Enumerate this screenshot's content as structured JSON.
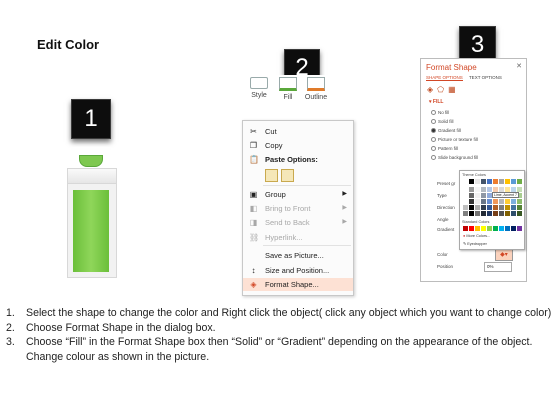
{
  "title": "Edit Color",
  "steps": [
    "1",
    "2",
    "3"
  ],
  "ribbon": {
    "items": [
      "Style",
      "Fill",
      "Outline"
    ]
  },
  "context_menu": {
    "items": [
      {
        "label": "Cut",
        "icon": "scissors-icon",
        "disabled": false,
        "arrow": false
      },
      {
        "label": "Copy",
        "icon": "copy-icon",
        "disabled": false,
        "arrow": false
      },
      {
        "label": "Paste Options:",
        "icon": "paste-icon",
        "disabled": false,
        "arrow": false,
        "bold": true
      },
      {
        "label": "Group",
        "icon": "group-icon",
        "disabled": false,
        "arrow": true
      },
      {
        "label": "Bring to Front",
        "icon": "bring-front-icon",
        "disabled": true,
        "arrow": true
      },
      {
        "label": "Send to Back",
        "icon": "send-back-icon",
        "disabled": true,
        "arrow": true
      },
      {
        "label": "Hyperlink...",
        "icon": "hyperlink-icon",
        "disabled": true,
        "arrow": false
      },
      {
        "label": "Save as Picture...",
        "icon": "",
        "disabled": false,
        "arrow": false
      },
      {
        "label": "Size and Position...",
        "icon": "size-position-icon",
        "disabled": false,
        "arrow": false
      },
      {
        "label": "Format Shape...",
        "icon": "format-shape-icon",
        "disabled": false,
        "arrow": false,
        "highlighted": true
      }
    ]
  },
  "format_panel": {
    "title": "Format Shape",
    "tabs": [
      "SHAPE OPTIONS",
      "TEXT OPTIONS"
    ],
    "section": "FILL",
    "options": [
      "No fill",
      "Solid fill",
      "Gradient fill",
      "Picture or texture fill",
      "Pattern fill",
      "Slide background fill"
    ],
    "labels": [
      "Preset gr",
      "Type",
      "Direction",
      "Angle",
      "Gradient",
      "Color",
      "Position"
    ],
    "position_value": "0%",
    "accent": "#d24726"
  },
  "color_picker": {
    "theme_header": "Theme Colors",
    "tooltip": "Lime, Accent 7",
    "standard_header": "Standard Colors",
    "more_colors": "More Colors...",
    "eyedropper": "Eyedropper"
  },
  "instructions": [
    {
      "num": "1.",
      "text": "Select the shape to change the color and Right click the object( click any object which you want to change color)"
    },
    {
      "num": "2.",
      "text": "Choose Format Shape in the dialog box."
    },
    {
      "num": "3.",
      "text": "Choose “Fill” in the Format Shape box then “Solid” or “Gradient” depending on the appearance of the object. Change colour as shown in the picture."
    }
  ]
}
